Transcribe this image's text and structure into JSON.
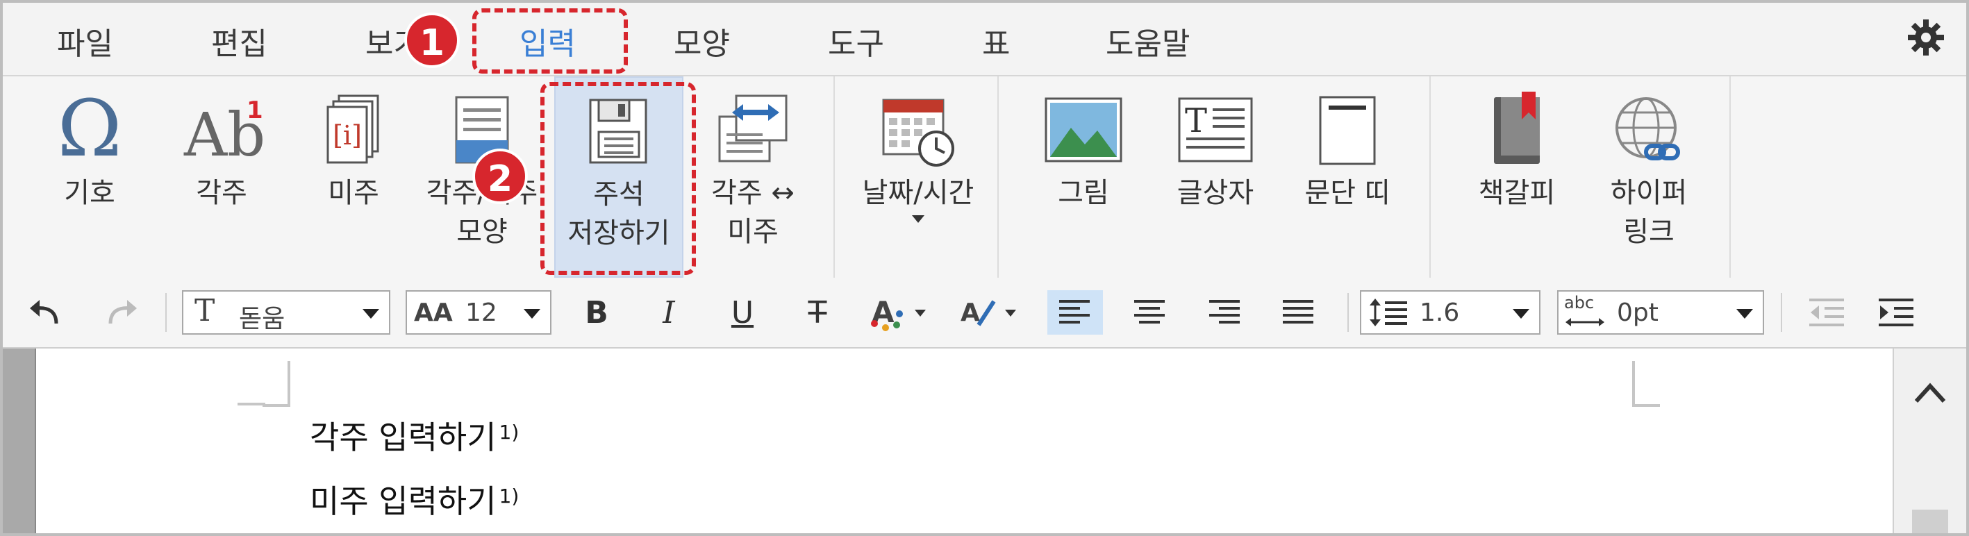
{
  "menu": {
    "items": [
      "파일",
      "편집",
      "보기",
      "입력",
      "모양",
      "도구",
      "표",
      "도움말"
    ],
    "active_index": 3,
    "settings_icon": "gear-icon"
  },
  "ribbon": {
    "items": [
      {
        "label": "기호",
        "icon": "omega-icon"
      },
      {
        "label": "각주",
        "icon": "footnote-icon"
      },
      {
        "label": "미주",
        "icon": "endnote-icon"
      },
      {
        "label": "각주/미주\n모양",
        "icon": "note-shape-icon"
      },
      {
        "label": "주석\n저장하기",
        "icon": "save-note-icon"
      },
      {
        "label": "각주 ↔\n미주",
        "icon": "swap-note-icon"
      },
      {
        "label": "날짜/시간",
        "icon": "date-time-icon"
      },
      {
        "label": "그림",
        "icon": "picture-icon"
      },
      {
        "label": "글상자",
        "icon": "textbox-icon"
      },
      {
        "label": "문단 띠",
        "icon": "paragraph-line-icon"
      },
      {
        "label": "책갈피",
        "icon": "bookmark-icon"
      },
      {
        "label": "하이퍼\n링크",
        "icon": "hyperlink-icon"
      }
    ],
    "selected_index": 4
  },
  "toolbar": {
    "font_name": "돋움",
    "font_size": "12",
    "line_spacing": "1.6",
    "letter_spacing": "0pt",
    "letter_spacing_prefix": "abc",
    "bold": "B",
    "italic": "I",
    "underline": "U",
    "strike": "T"
  },
  "document": {
    "lines": [
      {
        "text": "각주 입력하기",
        "sup": "1)"
      },
      {
        "text": "미주 입력하기",
        "sup": "1)"
      }
    ]
  },
  "annotations": {
    "badge1": "1",
    "badge2": "2"
  },
  "colors": {
    "accent": "#3a7fd5",
    "annotation_red": "#d7262d",
    "selected_ribbon": "#d5e1f2"
  }
}
